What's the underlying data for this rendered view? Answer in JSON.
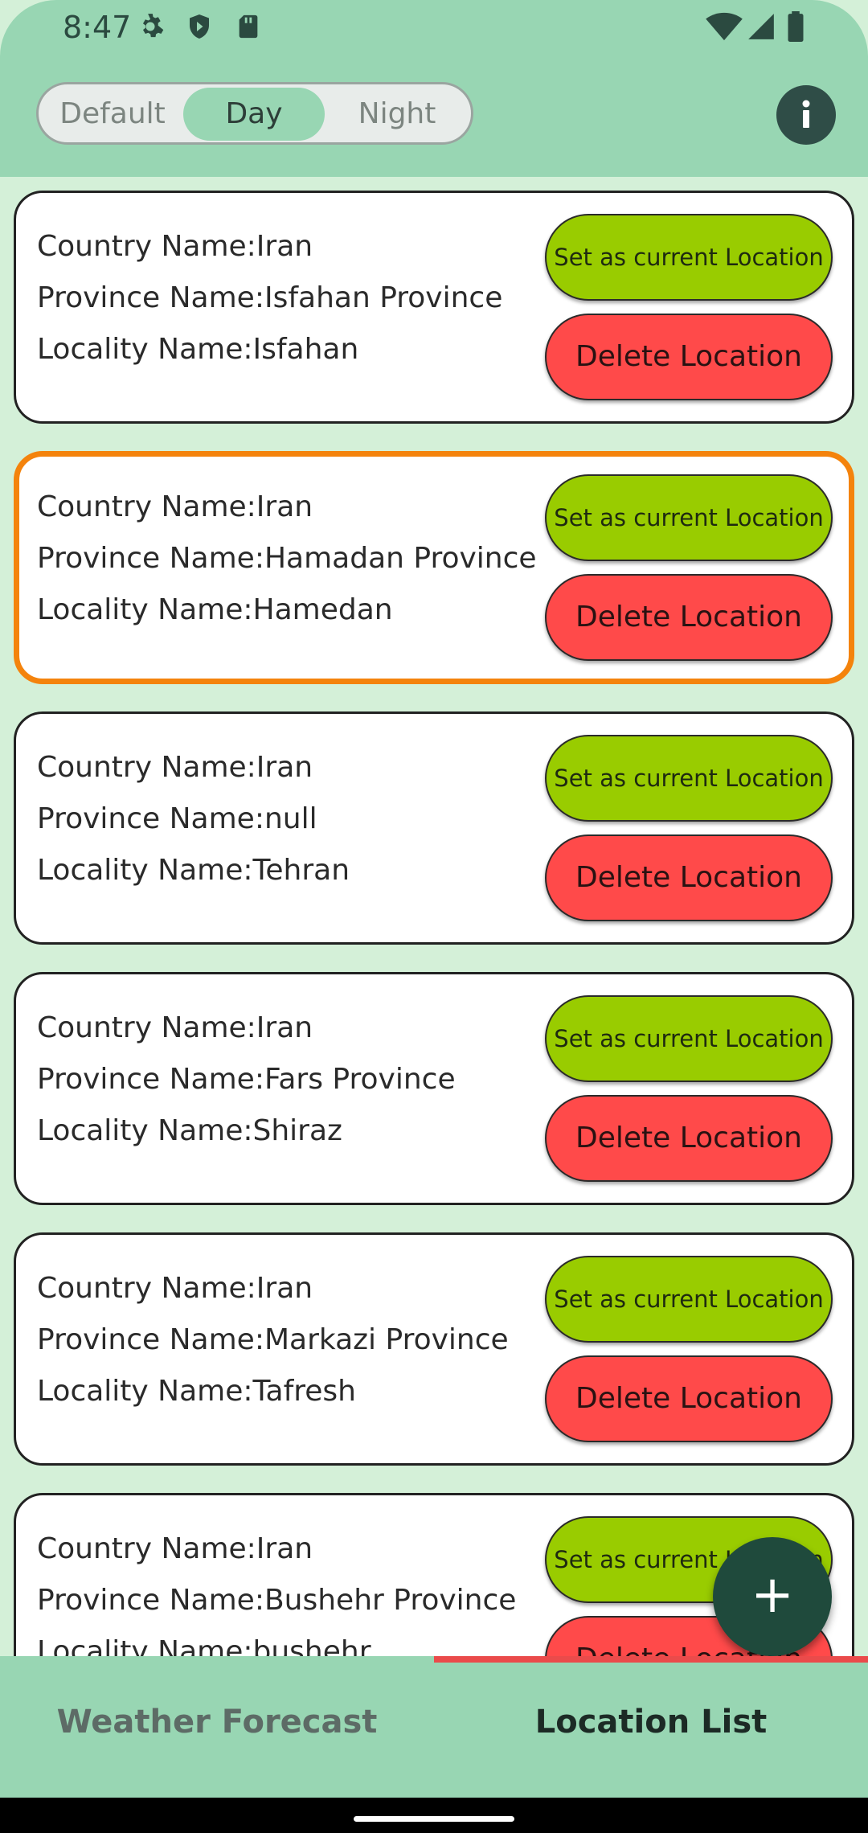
{
  "status_bar": {
    "time": "8:47"
  },
  "theme_toggle": {
    "options": [
      "Default",
      "Day",
      "Night"
    ],
    "selected": "Day"
  },
  "colors": {
    "primary": "#98d6b3",
    "set_button": "#99cc00",
    "delete_button": "#ff4a4a",
    "selected_border": "#f4830c",
    "fab": "#1f4a3c",
    "tab_indicator": "#ea4b4b"
  },
  "locations": [
    {
      "country": "Country Name:Iran",
      "province": "Province Name:Isfahan Province",
      "locality": "Locality Name:Isfahan",
      "set_label": "Set as current Location",
      "delete_label": "Delete Location"
    },
    {
      "country": "Country Name:Iran",
      "province": "Province Name:Hamadan Province",
      "locality": "Locality Name:Hamedan",
      "set_label": "Set as current Location",
      "delete_label": "Delete Location"
    },
    {
      "country": "Country Name:Iran",
      "province": "Province Name:null",
      "locality": "Locality Name:Tehran",
      "set_label": "Set as current Location",
      "delete_label": "Delete Location"
    },
    {
      "country": "Country Name:Iran",
      "province": "Province Name:Fars Province",
      "locality": "Locality Name:Shiraz",
      "set_label": "Set as current Location",
      "delete_label": "Delete Location"
    },
    {
      "country": "Country Name:Iran",
      "province": "Province Name:Markazi Province",
      "locality": "Locality Name:Tafresh",
      "set_label": "Set as current Location",
      "delete_label": "Delete Location"
    },
    {
      "country": "Country Name:Iran",
      "province": "Province Name:Bushehr Province",
      "locality": "Locality Name:bushehr",
      "set_label": "Set as current Location",
      "delete_label": "Delete Location"
    }
  ],
  "fab": {
    "label": "+"
  },
  "tabs": [
    {
      "label": "Weather Forecast",
      "active": false
    },
    {
      "label": "Location List",
      "active": true
    }
  ]
}
